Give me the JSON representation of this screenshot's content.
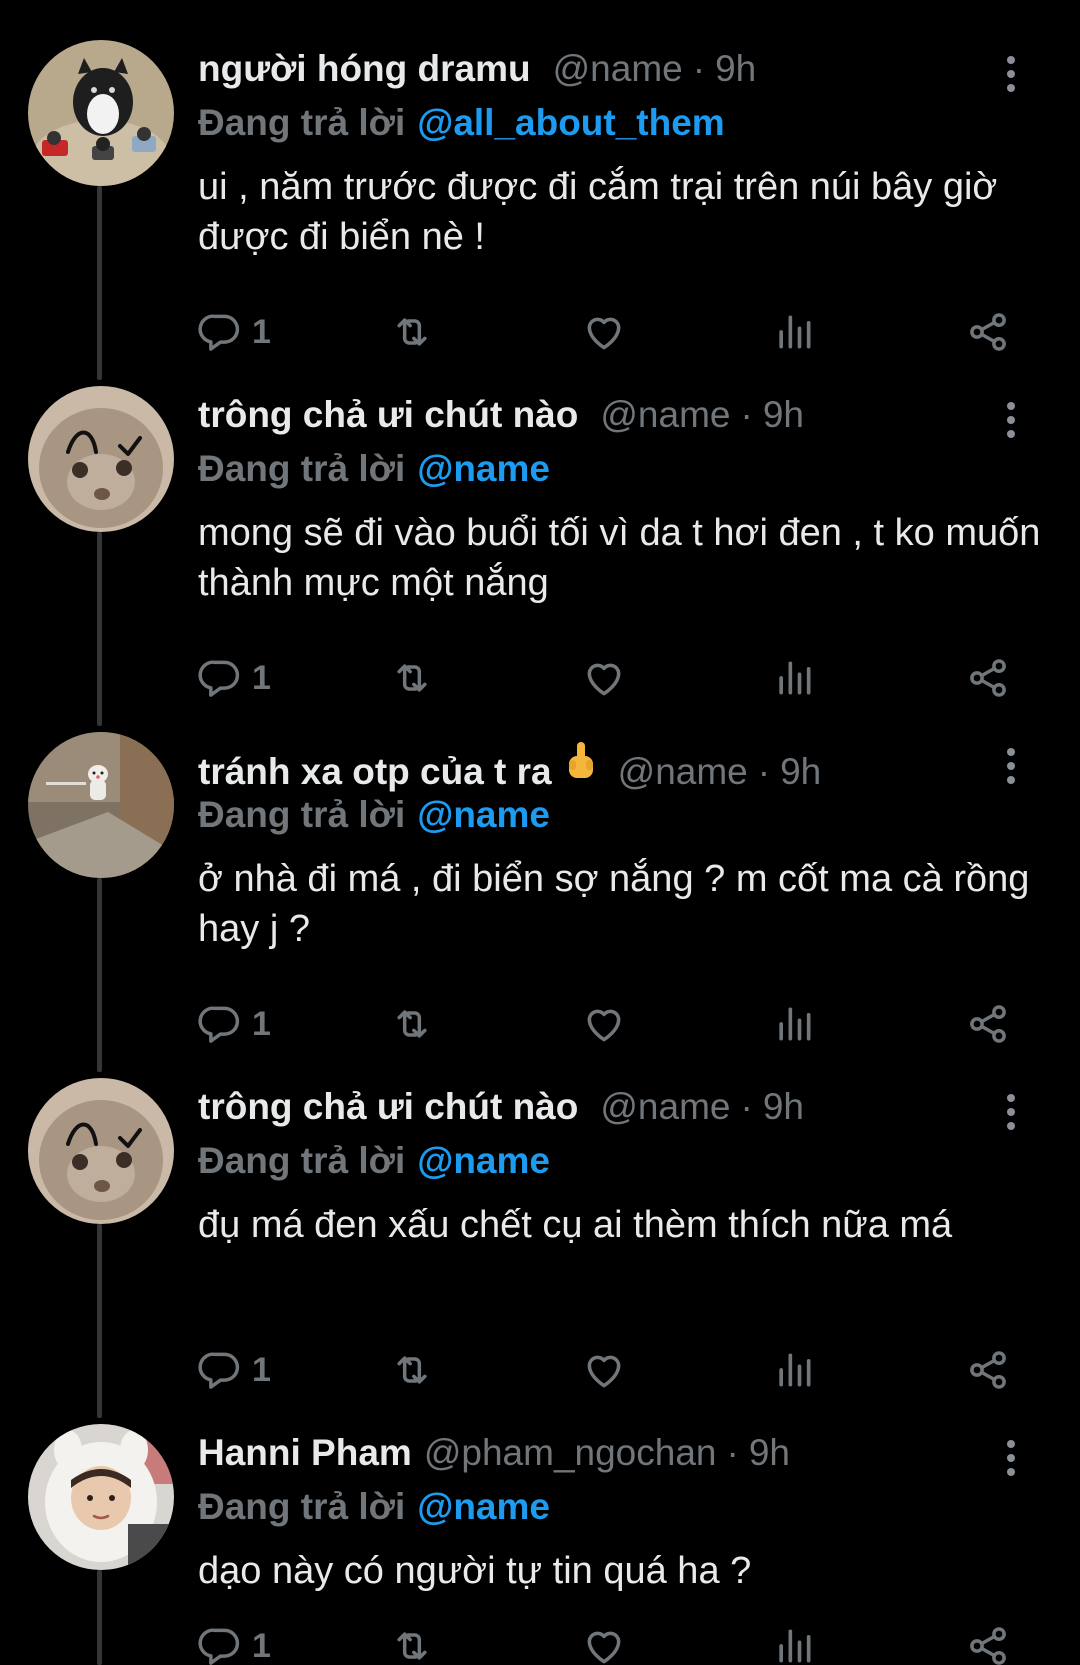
{
  "colors": {
    "background": "#000000",
    "text_primary": "#e7e9ea",
    "text_secondary": "#71767b",
    "accent_link": "#1d9bf0",
    "thread_line": "#333639"
  },
  "icons": {
    "more": "vertical-ellipsis",
    "reply": "speech-bubble",
    "retweet": "retweet-arrows",
    "like": "heart-outline",
    "views": "bar-chart",
    "share": "share-nodes"
  },
  "tweets": [
    {
      "display_name": "người hóng dramu",
      "handle": "@name",
      "dot": "·",
      "time": "9h",
      "replying_prefix": "Đang trả lời",
      "replying_to": "@all_about_them",
      "text": "ui , năm trước được đi cắm trại trên núi bây giờ được đi biển nè !",
      "reply_count": "1",
      "avatar": "cat-with-microphones"
    },
    {
      "display_name": "trông chả ưi chút nào",
      "handle": "@name",
      "dot": "·",
      "time": "9h",
      "replying_prefix": "Đang trả lời",
      "replying_to": "@name",
      "text": "mong sẽ đi vào buổi tối vì da t hơi đen , t ko muốn thành mực một nắng",
      "reply_count": "1",
      "avatar": "cat-face-drawn-eyebrows"
    },
    {
      "display_name": "tránh xa otp của t ra",
      "handle": "@name",
      "dot": "·",
      "time": "9h",
      "replying_prefix": "Đang trả lời",
      "replying_to": "@name",
      "text": "ở nhà đi má , đi biển sợ nắng ? m cốt ma cà rồng hay j ?",
      "reply_count": "1",
      "avatar": "small-toy-in-room"
    },
    {
      "display_name": "trông chả ưi chút nào",
      "handle": "@name",
      "dot": "·",
      "time": "9h",
      "replying_prefix": "Đang trả lời",
      "replying_to": "@name",
      "text": "đụ má đen xấu chết cụ ai thèm thích nữa má",
      "reply_count": "1",
      "avatar": "cat-face-drawn-eyebrows"
    },
    {
      "display_name": "Hanni Pham",
      "handle": "@pham_ngochan",
      "dot": "·",
      "time": "9h",
      "replying_prefix": "Đang trả lời",
      "replying_to": "@name",
      "text": "dạo này có người tự tin quá ha ?",
      "reply_count": "1",
      "avatar": "girl-in-white-hood"
    }
  ]
}
